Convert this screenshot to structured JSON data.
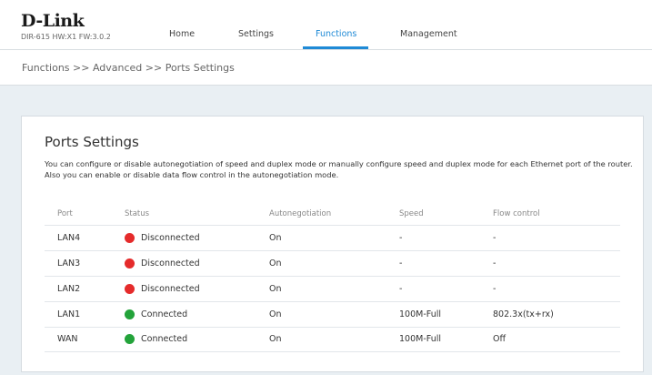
{
  "header": {
    "logo": "D-Link",
    "model": "DIR-615 HW:X1 FW:3.0.2",
    "tabs": [
      {
        "label": "Home",
        "active": false
      },
      {
        "label": "Settings",
        "active": false
      },
      {
        "label": "Functions",
        "active": true
      },
      {
        "label": "Management",
        "active": false
      }
    ]
  },
  "breadcrumb": "Functions >> Advanced >> Ports Settings",
  "panel": {
    "title": "Ports Settings",
    "description": "You can configure or disable autonegotiation of speed and duplex mode or manually configure speed and duplex mode for each Ethernet port of the router. Also you can enable or disable data flow control in the autonegotiation mode."
  },
  "table": {
    "columns": [
      "Port",
      "Status",
      "Autonegotiation",
      "Speed",
      "Flow control"
    ],
    "rows": [
      {
        "port": "LAN4",
        "status": "Disconnected",
        "status_color": "#e52b2b",
        "autoneg": "On",
        "speed": "-",
        "flow": "-"
      },
      {
        "port": "LAN3",
        "status": "Disconnected",
        "status_color": "#e52b2b",
        "autoneg": "On",
        "speed": "-",
        "flow": "-"
      },
      {
        "port": "LAN2",
        "status": "Disconnected",
        "status_color": "#e52b2b",
        "autoneg": "On",
        "speed": "-",
        "flow": "-"
      },
      {
        "port": "LAN1",
        "status": "Connected",
        "status_color": "#23a33a",
        "autoneg": "On",
        "speed": "100M-Full",
        "flow": "802.3x(tx+rx)"
      },
      {
        "port": "WAN",
        "status": "Connected",
        "status_color": "#23a33a",
        "autoneg": "On",
        "speed": "100M-Full",
        "flow": "Off"
      }
    ]
  },
  "colors": {
    "accent": "#1f8ad6",
    "disconnected": "#e52b2b",
    "connected": "#23a33a"
  }
}
